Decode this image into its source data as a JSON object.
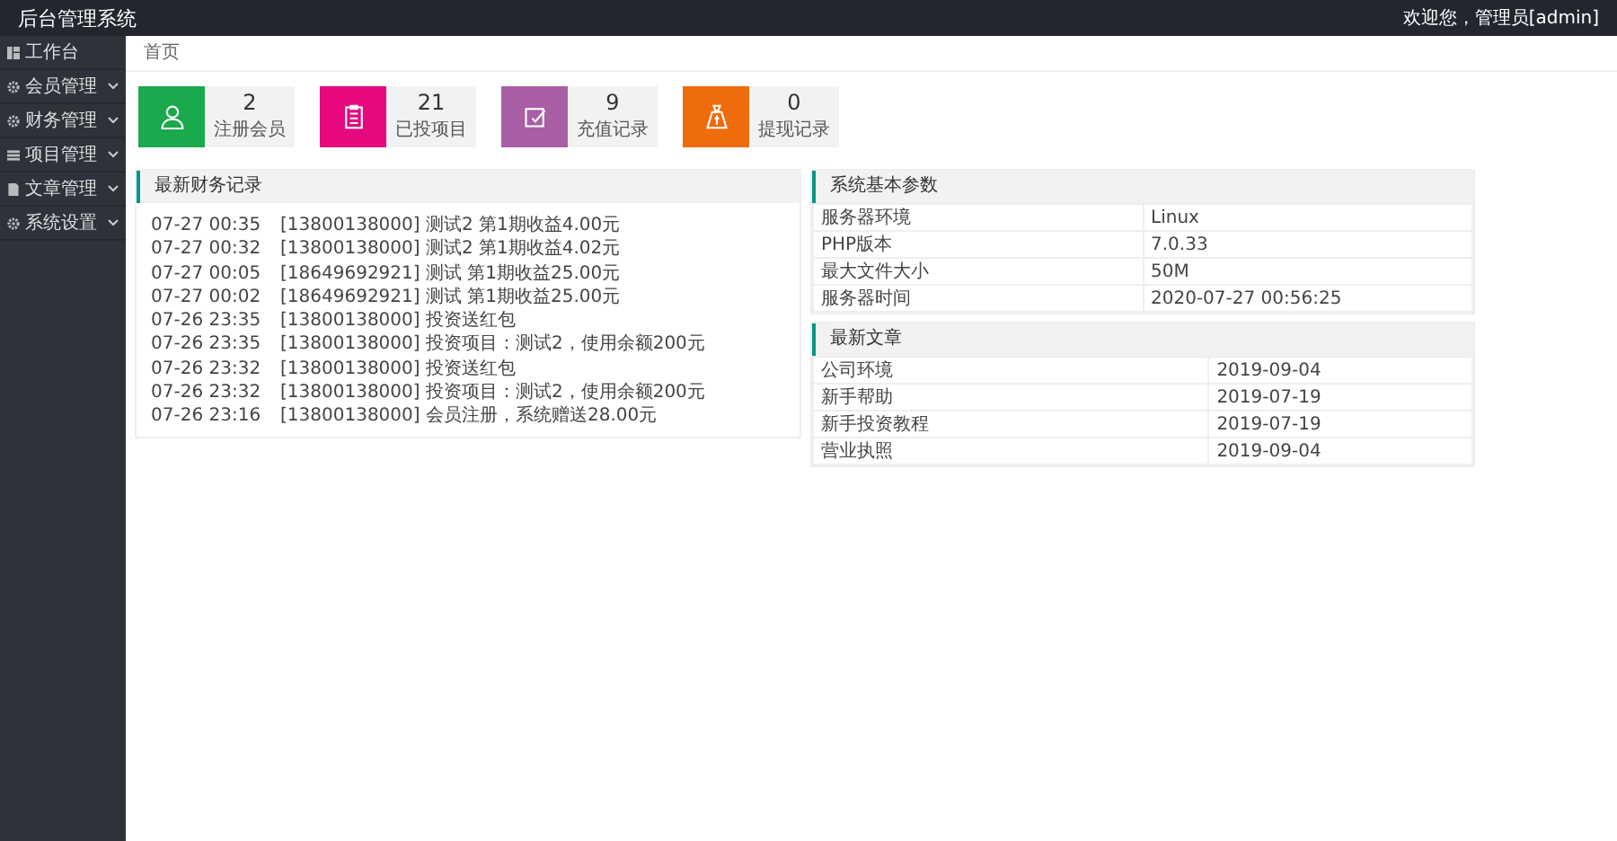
{
  "header": {
    "title": "后台管理系统",
    "user_menu": "欢迎您，管理员[admin]"
  },
  "sidebar": {
    "items": [
      {
        "label": "工作台",
        "kind": "dashboard",
        "has_submenu": false
      },
      {
        "label": "会员管理",
        "kind": "gear",
        "has_submenu": true
      },
      {
        "label": "财务管理",
        "kind": "gear",
        "has_submenu": true
      },
      {
        "label": "项目管理",
        "kind": "list",
        "has_submenu": true
      },
      {
        "label": "文章管理",
        "kind": "doc",
        "has_submenu": true
      },
      {
        "label": "系统设置",
        "kind": "gear",
        "has_submenu": true
      }
    ]
  },
  "breadcrumb": "首页",
  "stats": [
    {
      "value": "2",
      "label": "注册会员",
      "kind": "user",
      "color": "#1aa94c"
    },
    {
      "value": "21",
      "label": "已投项目",
      "kind": "clipboard",
      "color": "#e6097f"
    },
    {
      "value": "9",
      "label": "充值记录",
      "kind": "edit",
      "color": "#a95ea5"
    },
    {
      "value": "0",
      "label": "提现记录",
      "kind": "bag",
      "color": "#ef6c0d"
    }
  ],
  "finance_panel": {
    "title": "最新财务记录",
    "records": [
      {
        "time": "07-27 00:35",
        "text": "[13800138000] 测试2 第1期收益4.00元"
      },
      {
        "time": "07-27 00:32",
        "text": "[13800138000] 测试2 第1期收益4.02元"
      },
      {
        "time": "07-27 00:05",
        "text": "[18649692921] 测试 第1期收益25.00元"
      },
      {
        "time": "07-27 00:02",
        "text": "[18649692921] 测试 第1期收益25.00元"
      },
      {
        "time": "07-26 23:35",
        "text": "[13800138000] 投资送红包"
      },
      {
        "time": "07-26 23:35",
        "text": "[13800138000] 投资项目：测试2，使用余额200元"
      },
      {
        "time": "07-26 23:32",
        "text": "[13800138000] 投资送红包"
      },
      {
        "time": "07-26 23:32",
        "text": "[13800138000] 投资项目：测试2，使用余额200元"
      },
      {
        "time": "07-26 23:16",
        "text": "[13800138000] 会员注册，系统赠送28.00元"
      }
    ]
  },
  "system_panel": {
    "title": "系统基本参数",
    "rows": [
      {
        "name": "服务器环境",
        "value": "Linux"
      },
      {
        "name": "PHP版本",
        "value": "7.0.33"
      },
      {
        "name": "最大文件大小",
        "value": "50M"
      },
      {
        "name": "服务器时间",
        "value": "2020-07-27 00:56:25"
      }
    ]
  },
  "articles_panel": {
    "title": "最新文章",
    "rows": [
      {
        "name": "公司环境",
        "value": "2019-09-04"
      },
      {
        "name": "新手帮助",
        "value": "2019-07-19"
      },
      {
        "name": "新手投资教程",
        "value": "2019-07-19"
      },
      {
        "name": "营业执照",
        "value": "2019-09-04"
      }
    ]
  }
}
